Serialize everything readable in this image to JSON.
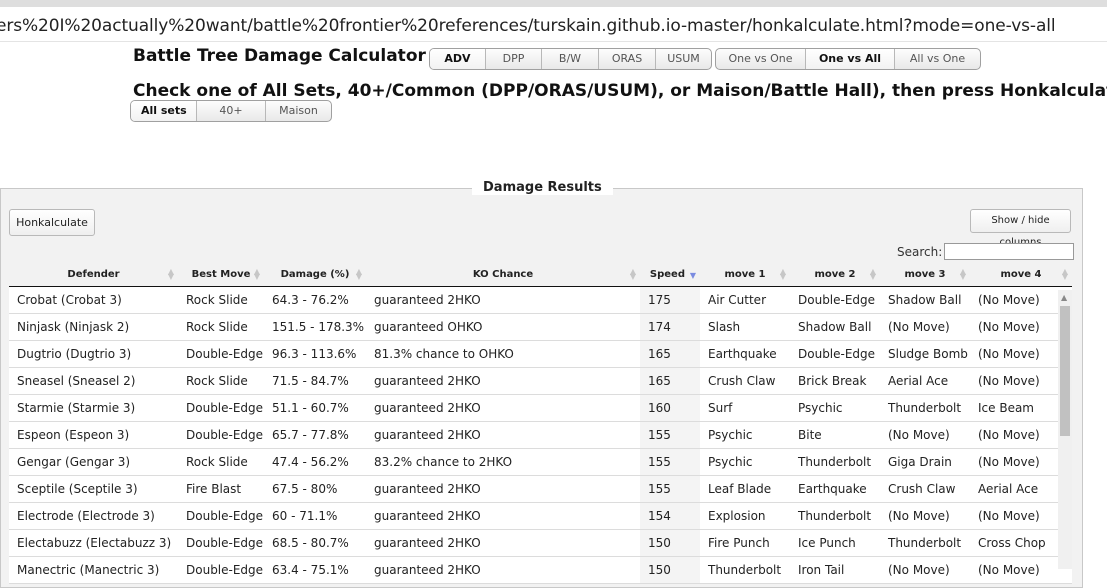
{
  "browser": {
    "url": "ers%20I%20actually%20want/battle%20frontier%20references/turskain.github.io-master/honkalculate.html?mode=one-vs-all"
  },
  "page": {
    "title": "Battle Tree Damage Calculator",
    "gen_buttons": [
      "ADV",
      "DPP",
      "B/W",
      "ORAS",
      "USUM"
    ],
    "gen_selected": "ADV",
    "mode_buttons": [
      "One vs One",
      "One vs All",
      "All vs One"
    ],
    "mode_selected": "One vs All",
    "instruction": "Check one of All Sets, 40+/Common (DPP/ORAS/USUM), or Maison/Battle Hall), then press Honkalculate:",
    "set_buttons": [
      "All sets",
      "40+",
      "Maison"
    ],
    "set_selected": "All sets"
  },
  "results": {
    "legend": "Damage Results",
    "honk_button": "Honkalculate",
    "columns_button": "Show / hide columns",
    "search_label": "Search:",
    "search_value": "",
    "columns": [
      "Defender",
      "Best Move",
      "Damage (%)",
      "KO Chance",
      "Speed",
      "move 1",
      "move 2",
      "move 3",
      "move 4"
    ],
    "sorted_column": "Speed",
    "sort_direction": "descending",
    "rows": [
      [
        "Crobat (Crobat 3)",
        "Rock Slide",
        "64.3 - 76.2%",
        "guaranteed 2HKO",
        "175",
        "Air Cutter",
        "Double-Edge",
        "Shadow Ball",
        "(No Move)"
      ],
      [
        "Ninjask (Ninjask 2)",
        "Rock Slide",
        "151.5 - 178.3%",
        "guaranteed OHKO",
        "174",
        "Slash",
        "Shadow Ball",
        "(No Move)",
        "(No Move)"
      ],
      [
        "Dugtrio (Dugtrio 3)",
        "Double-Edge",
        "96.3 - 113.6%",
        "81.3% chance to OHKO",
        "165",
        "Earthquake",
        "Double-Edge",
        "Sludge Bomb",
        "(No Move)"
      ],
      [
        "Sneasel (Sneasel 2)",
        "Rock Slide",
        "71.5 - 84.7%",
        "guaranteed 2HKO",
        "165",
        "Crush Claw",
        "Brick Break",
        "Aerial Ace",
        "(No Move)"
      ],
      [
        "Starmie (Starmie 3)",
        "Double-Edge",
        "51.1 - 60.7%",
        "guaranteed 2HKO",
        "160",
        "Surf",
        "Psychic",
        "Thunderbolt",
        "Ice Beam"
      ],
      [
        "Espeon (Espeon 3)",
        "Double-Edge",
        "65.7 - 77.8%",
        "guaranteed 2HKO",
        "155",
        "Psychic",
        "Bite",
        "(No Move)",
        "(No Move)"
      ],
      [
        "Gengar (Gengar 3)",
        "Rock Slide",
        "47.4 - 56.2%",
        "83.2% chance to 2HKO",
        "155",
        "Psychic",
        "Thunderbolt",
        "Giga Drain",
        "(No Move)"
      ],
      [
        "Sceptile (Sceptile 3)",
        "Fire Blast",
        "67.5 - 80%",
        "guaranteed 2HKO",
        "155",
        "Leaf Blade",
        "Earthquake",
        "Crush Claw",
        "Aerial Ace"
      ],
      [
        "Electrode (Electrode 3)",
        "Double-Edge",
        "60 - 71.1%",
        "guaranteed 2HKO",
        "154",
        "Explosion",
        "Thunderbolt",
        "(No Move)",
        "(No Move)"
      ],
      [
        "Electabuzz (Electabuzz 3)",
        "Double-Edge",
        "68.5 - 80.7%",
        "guaranteed 2HKO",
        "150",
        "Fire Punch",
        "Ice Punch",
        "Thunderbolt",
        "Cross Chop"
      ],
      [
        "Manectric (Manectric 3)",
        "Double-Edge",
        "63.4 - 75.1%",
        "guaranteed 2HKO",
        "150",
        "Thunderbolt",
        "Iron Tail",
        "(No Move)",
        "(No Move)"
      ]
    ]
  }
}
